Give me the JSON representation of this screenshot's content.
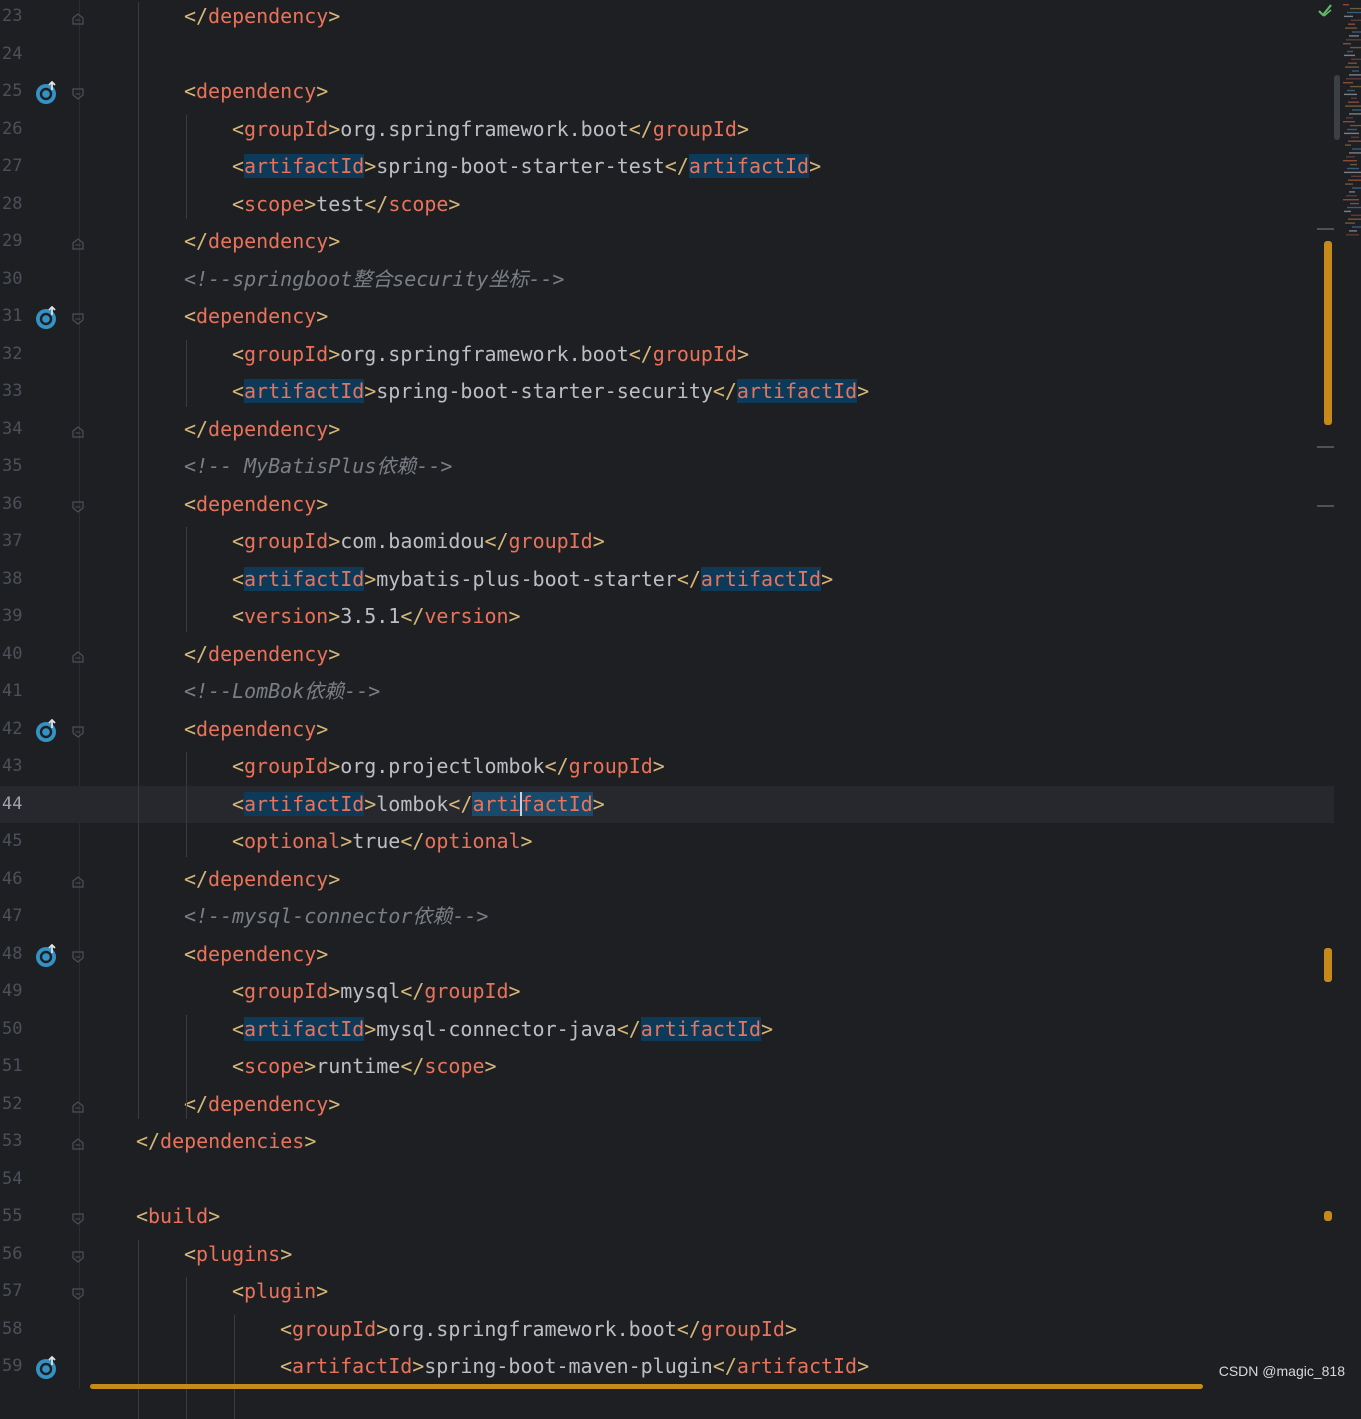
{
  "lines": [
    {
      "n": "23",
      "indent": 2,
      "parts": [
        [
          "b",
          "</"
        ],
        [
          "t",
          "dependency"
        ],
        [
          "b",
          ">"
        ]
      ],
      "fold": "end"
    },
    {
      "n": "24",
      "indent": 2,
      "parts": []
    },
    {
      "n": "25",
      "indent": 2,
      "parts": [
        [
          "b",
          "<"
        ],
        [
          "t",
          "dependency"
        ],
        [
          "b",
          ">"
        ]
      ],
      "fold": "start",
      "icon": true
    },
    {
      "n": "26",
      "indent": 3,
      "parts": [
        [
          "b",
          "<"
        ],
        [
          "t",
          "groupId"
        ],
        [
          "b",
          ">"
        ],
        [
          "tx",
          "org.springframework.boot"
        ],
        [
          "b",
          "</"
        ],
        [
          "t",
          "groupId"
        ],
        [
          "b",
          ">"
        ]
      ]
    },
    {
      "n": "27",
      "indent": 3,
      "parts": [
        [
          "b",
          "<"
        ],
        [
          "th",
          "artifactId"
        ],
        [
          "b",
          ">"
        ],
        [
          "tx",
          "spring-boot-starter-test"
        ],
        [
          "b",
          "</"
        ],
        [
          "th",
          "artifactId"
        ],
        [
          "b",
          ">"
        ]
      ]
    },
    {
      "n": "28",
      "indent": 3,
      "parts": [
        [
          "b",
          "<"
        ],
        [
          "t",
          "scope"
        ],
        [
          "b",
          ">"
        ],
        [
          "tx",
          "test"
        ],
        [
          "b",
          "</"
        ],
        [
          "t",
          "scope"
        ],
        [
          "b",
          ">"
        ]
      ]
    },
    {
      "n": "29",
      "indent": 2,
      "parts": [
        [
          "b",
          "</"
        ],
        [
          "t",
          "dependency"
        ],
        [
          "b",
          ">"
        ]
      ],
      "fold": "end"
    },
    {
      "n": "30",
      "indent": 2,
      "parts": [
        [
          "cm",
          "<!--springboot整合security坐标-->"
        ]
      ]
    },
    {
      "n": "31",
      "indent": 2,
      "parts": [
        [
          "b",
          "<"
        ],
        [
          "t",
          "dependency"
        ],
        [
          "b",
          ">"
        ]
      ],
      "fold": "start",
      "icon": true
    },
    {
      "n": "32",
      "indent": 3,
      "parts": [
        [
          "b",
          "<"
        ],
        [
          "t",
          "groupId"
        ],
        [
          "b",
          ">"
        ],
        [
          "tx",
          "org.springframework.boot"
        ],
        [
          "b",
          "</"
        ],
        [
          "t",
          "groupId"
        ],
        [
          "b",
          ">"
        ]
      ]
    },
    {
      "n": "33",
      "indent": 3,
      "parts": [
        [
          "b",
          "<"
        ],
        [
          "th",
          "artifactId"
        ],
        [
          "b",
          ">"
        ],
        [
          "tx",
          "spring-boot-starter-security"
        ],
        [
          "b",
          "</"
        ],
        [
          "th",
          "artifactId"
        ],
        [
          "b",
          ">"
        ]
      ]
    },
    {
      "n": "34",
      "indent": 2,
      "parts": [
        [
          "b",
          "</"
        ],
        [
          "t",
          "dependency"
        ],
        [
          "b",
          ">"
        ]
      ],
      "fold": "end"
    },
    {
      "n": "35",
      "indent": 2,
      "parts": [
        [
          "cm",
          "<!-- MyBatisPlus依赖-->"
        ]
      ]
    },
    {
      "n": "36",
      "indent": 2,
      "parts": [
        [
          "b",
          "<"
        ],
        [
          "t",
          "dependency"
        ],
        [
          "b",
          ">"
        ]
      ],
      "fold": "start"
    },
    {
      "n": "37",
      "indent": 3,
      "parts": [
        [
          "b",
          "<"
        ],
        [
          "t",
          "groupId"
        ],
        [
          "b",
          ">"
        ],
        [
          "tx",
          "com.baomidou"
        ],
        [
          "b",
          "</"
        ],
        [
          "t",
          "groupId"
        ],
        [
          "b",
          ">"
        ]
      ]
    },
    {
      "n": "38",
      "indent": 3,
      "parts": [
        [
          "b",
          "<"
        ],
        [
          "th",
          "artifactId"
        ],
        [
          "b",
          ">"
        ],
        [
          "tx",
          "mybatis-plus-boot-starter"
        ],
        [
          "b",
          "</"
        ],
        [
          "th",
          "artifactId"
        ],
        [
          "b",
          ">"
        ]
      ]
    },
    {
      "n": "39",
      "indent": 3,
      "parts": [
        [
          "b",
          "<"
        ],
        [
          "t",
          "version"
        ],
        [
          "b",
          ">"
        ],
        [
          "tx",
          "3.5.1"
        ],
        [
          "b",
          "</"
        ],
        [
          "t",
          "version"
        ],
        [
          "b",
          ">"
        ]
      ]
    },
    {
      "n": "40",
      "indent": 2,
      "parts": [
        [
          "b",
          "</"
        ],
        [
          "t",
          "dependency"
        ],
        [
          "b",
          ">"
        ]
      ],
      "fold": "end"
    },
    {
      "n": "41",
      "indent": 2,
      "parts": [
        [
          "cm",
          "<!--LomBok依赖-->"
        ]
      ]
    },
    {
      "n": "42",
      "indent": 2,
      "parts": [
        [
          "b",
          "<"
        ],
        [
          "t",
          "dependency"
        ],
        [
          "b",
          ">"
        ]
      ],
      "fold": "start",
      "icon": true
    },
    {
      "n": "43",
      "indent": 3,
      "parts": [
        [
          "b",
          "<"
        ],
        [
          "t",
          "groupId"
        ],
        [
          "b",
          ">"
        ],
        [
          "tx",
          "org.projectlombok"
        ],
        [
          "b",
          "</"
        ],
        [
          "t",
          "groupId"
        ],
        [
          "b",
          ">"
        ]
      ]
    },
    {
      "n": "44",
      "indent": 3,
      "parts": [
        [
          "b",
          "<"
        ],
        [
          "th",
          "artifactId"
        ],
        [
          "b",
          ">"
        ],
        [
          "tx",
          "lombok"
        ],
        [
          "b",
          "</"
        ],
        [
          "thc",
          "arti|factId"
        ],
        [
          "b",
          ">"
        ]
      ],
      "current": true
    },
    {
      "n": "45",
      "indent": 3,
      "parts": [
        [
          "b",
          "<"
        ],
        [
          "t",
          "optional"
        ],
        [
          "b",
          ">"
        ],
        [
          "tx",
          "true"
        ],
        [
          "b",
          "</"
        ],
        [
          "t",
          "optional"
        ],
        [
          "b",
          ">"
        ]
      ]
    },
    {
      "n": "46",
      "indent": 2,
      "parts": [
        [
          "b",
          "</"
        ],
        [
          "t",
          "dependency"
        ],
        [
          "b",
          ">"
        ]
      ],
      "fold": "end"
    },
    {
      "n": "47",
      "indent": 2,
      "parts": [
        [
          "cm",
          "<!--mysql-connector依赖-->"
        ]
      ]
    },
    {
      "n": "48",
      "indent": 2,
      "parts": [
        [
          "b",
          "<"
        ],
        [
          "t",
          "dependency"
        ],
        [
          "b",
          ">"
        ]
      ],
      "fold": "start",
      "icon": true
    },
    {
      "n": "49",
      "indent": 3,
      "parts": [
        [
          "b",
          "<"
        ],
        [
          "t",
          "groupId"
        ],
        [
          "b",
          ">"
        ],
        [
          "tx",
          "mysql"
        ],
        [
          "b",
          "</"
        ],
        [
          "t",
          "groupId"
        ],
        [
          "b",
          ">"
        ]
      ]
    },
    {
      "n": "50",
      "indent": 3,
      "parts": [
        [
          "b",
          "<"
        ],
        [
          "th",
          "artifactId"
        ],
        [
          "b",
          ">"
        ],
        [
          "tx",
          "mysql-connector-java"
        ],
        [
          "b",
          "</"
        ],
        [
          "th",
          "artifactId"
        ],
        [
          "b",
          ">"
        ]
      ]
    },
    {
      "n": "51",
      "indent": 3,
      "parts": [
        [
          "b",
          "<"
        ],
        [
          "t",
          "scope"
        ],
        [
          "b",
          ">"
        ],
        [
          "tx",
          "runtime"
        ],
        [
          "b",
          "</"
        ],
        [
          "t",
          "scope"
        ],
        [
          "b",
          ">"
        ]
      ]
    },
    {
      "n": "52",
      "indent": 2,
      "parts": [
        [
          "b",
          "</"
        ],
        [
          "t",
          "dependency"
        ],
        [
          "b",
          ">"
        ]
      ],
      "fold": "end"
    },
    {
      "n": "53",
      "indent": 1,
      "parts": [
        [
          "b",
          "</"
        ],
        [
          "t",
          "dependencies"
        ],
        [
          "b",
          ">"
        ]
      ],
      "fold": "end"
    },
    {
      "n": "54",
      "indent": 1,
      "parts": []
    },
    {
      "n": "55",
      "indent": 1,
      "parts": [
        [
          "b",
          "<"
        ],
        [
          "t",
          "build"
        ],
        [
          "b",
          ">"
        ]
      ],
      "fold": "start"
    },
    {
      "n": "56",
      "indent": 2,
      "parts": [
        [
          "b",
          "<"
        ],
        [
          "t",
          "plugins"
        ],
        [
          "b",
          ">"
        ]
      ],
      "fold": "start"
    },
    {
      "n": "57",
      "indent": 3,
      "parts": [
        [
          "b",
          "<"
        ],
        [
          "t",
          "plugin"
        ],
        [
          "b",
          ">"
        ]
      ],
      "fold": "start"
    },
    {
      "n": "58",
      "indent": 4,
      "parts": [
        [
          "b",
          "<"
        ],
        [
          "t",
          "groupId"
        ],
        [
          "b",
          ">"
        ],
        [
          "tx",
          "org.springframework.boot"
        ],
        [
          "b",
          "</"
        ],
        [
          "t",
          "groupId"
        ],
        [
          "b",
          ">"
        ]
      ]
    },
    {
      "n": "59",
      "indent": 4,
      "parts": [
        [
          "b",
          "<"
        ],
        [
          "t",
          "artifactId"
        ],
        [
          "b",
          ">"
        ],
        [
          "tx",
          "spring-boot-maven-plugin"
        ],
        [
          "b",
          "</"
        ],
        [
          "t",
          "artifactId"
        ],
        [
          "b",
          ">"
        ]
      ],
      "icon": true
    }
  ],
  "watermark": "CSDN @magic_818",
  "icons": {
    "gutter": "maven-dependency-icon",
    "fold_start": "fold-open-icon",
    "fold_end": "fold-close-icon",
    "inspection": "checkmark-icon"
  },
  "colors": {
    "background": "#1e1f22",
    "tag": "#e8735a",
    "bracket": "#d5b778",
    "text": "#bcbec4",
    "comment": "#7a7e85",
    "highlight": "#0e3a5a",
    "scroll_mark": "#c78a1a"
  }
}
